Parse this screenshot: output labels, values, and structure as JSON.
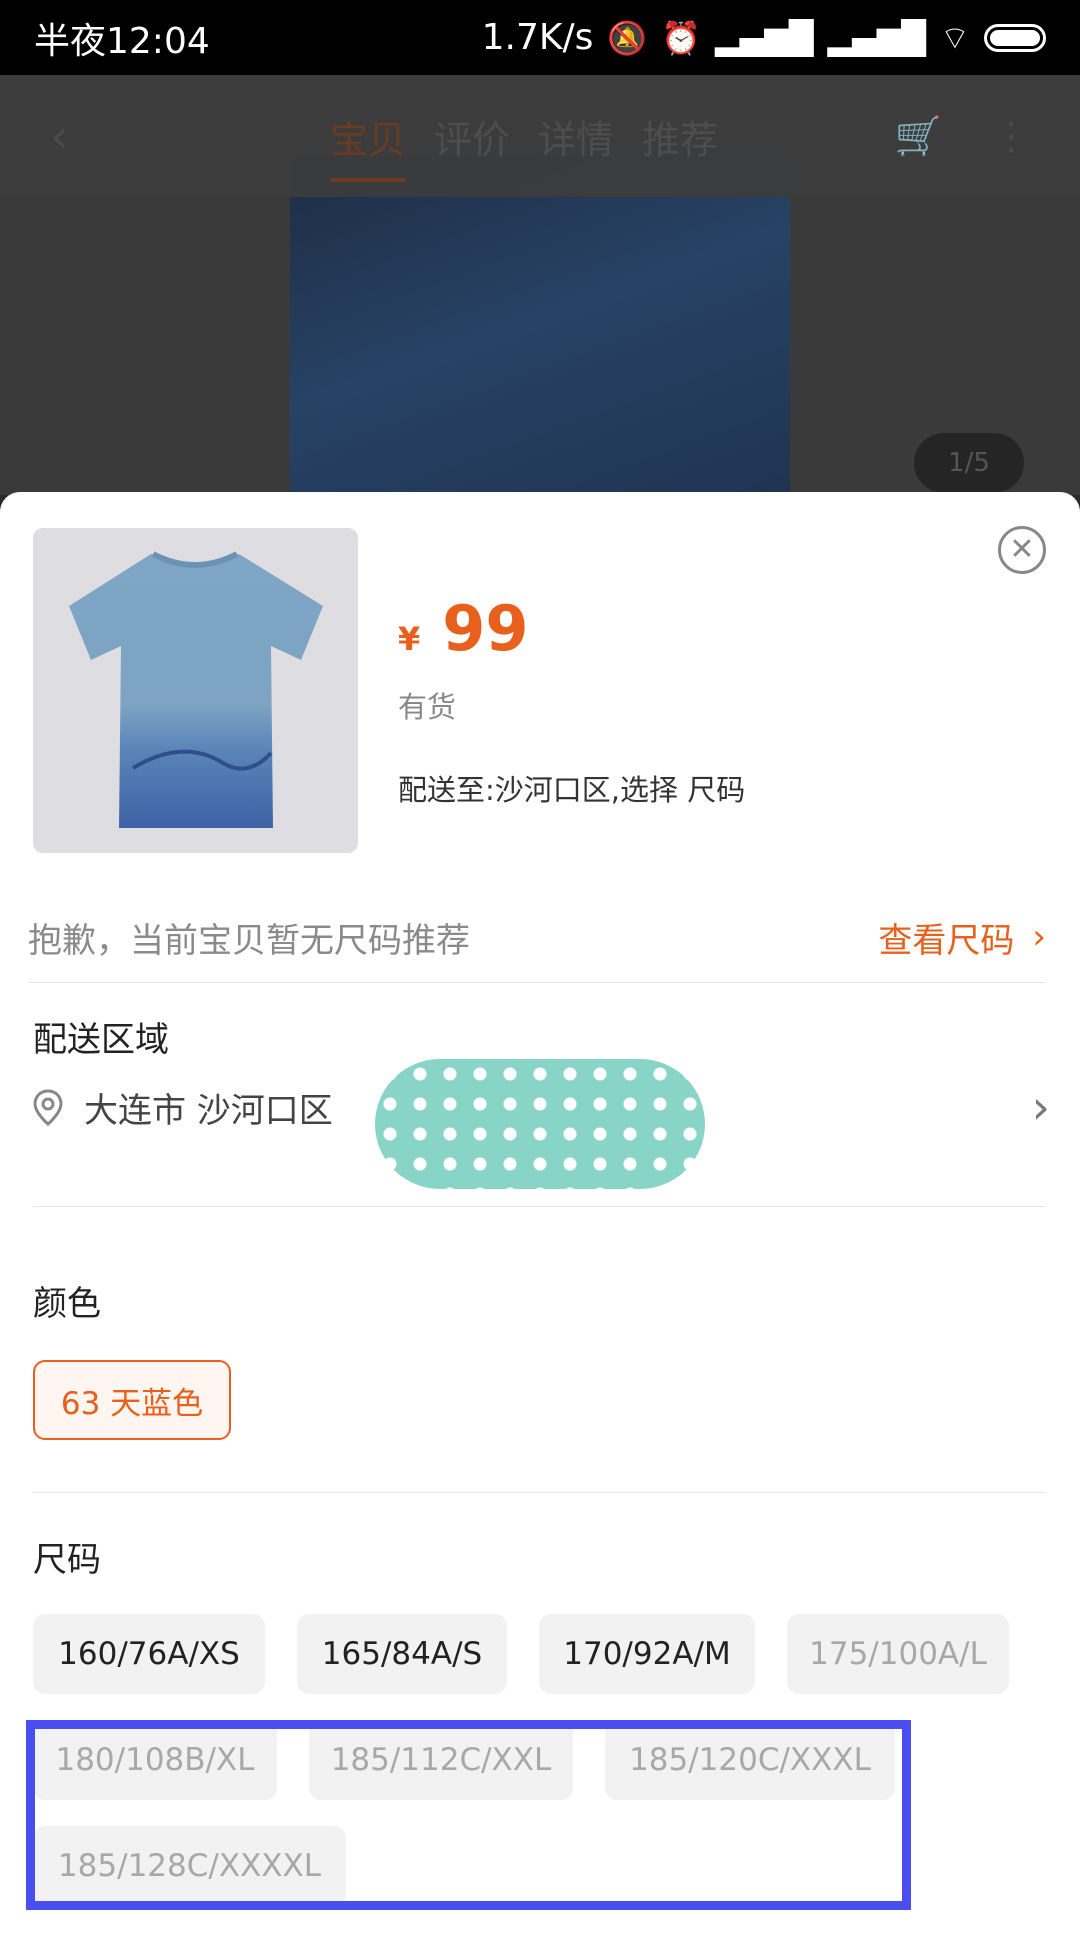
{
  "status_bar": {
    "time": "半夜12:04",
    "speed": "1.7K/s"
  },
  "background": {
    "tabs": [
      "宝贝",
      "评价",
      "详情",
      "推荐"
    ],
    "image_counter": "1/5"
  },
  "product": {
    "currency": "¥",
    "price": "99",
    "stock": "有货",
    "ship_to": "配送至:沙河口区,选择 尺码"
  },
  "recommend": {
    "text": "抱歉，当前宝贝暂无尺码推荐",
    "link": "查看尺码"
  },
  "delivery": {
    "title": "配送区域",
    "region": "大连市 沙河口区"
  },
  "color": {
    "title": "颜色",
    "selected": "63 天蓝色"
  },
  "size": {
    "title": "尺码",
    "options": [
      {
        "label": "160/76A/XS",
        "available": true
      },
      {
        "label": "165/84A/S",
        "available": true
      },
      {
        "label": "170/92A/M",
        "available": true
      },
      {
        "label": "175/100A/L",
        "available": false
      },
      {
        "label": "180/108B/XL",
        "available": false
      },
      {
        "label": "185/112C/XXL",
        "available": false
      },
      {
        "label": "185/120C/XXXL",
        "available": false
      },
      {
        "label": "185/128C/XXXXL",
        "available": false
      }
    ]
  },
  "colors": {
    "accent": "#e8601c",
    "highlight_box": "#4a4df0"
  }
}
